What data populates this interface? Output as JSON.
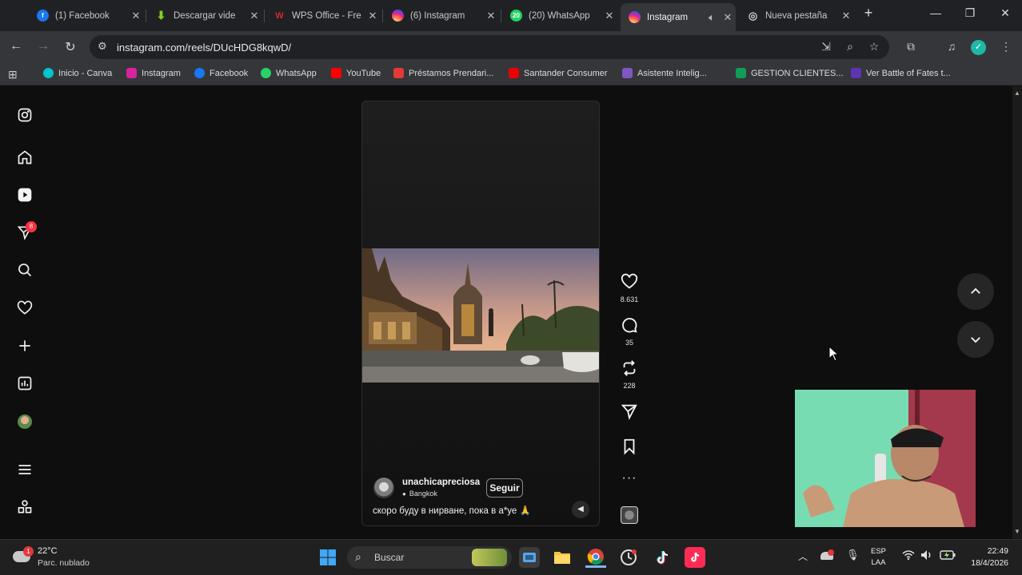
{
  "tabs": [
    {
      "title": "(1) Facebook",
      "icon": "facebook-icon",
      "color": "#1877f2"
    },
    {
      "title": "Descargar vide",
      "icon": "download-icon",
      "color": "#4caf50"
    },
    {
      "title": "WPS Office - Fre",
      "icon": "wps-icon",
      "color": "#d62a2a"
    },
    {
      "title": "(6) Instagram",
      "icon": "instagram-icon",
      "color": "#d6249f"
    },
    {
      "title": "(20) WhatsApp",
      "icon": "whatsapp-icon",
      "color": "#25d366",
      "badge": "20"
    },
    {
      "title": "Instagram",
      "icon": "instagram-icon",
      "color": "#d6249f",
      "active": true
    },
    {
      "title": "Nueva pestaña",
      "icon": "chrome-icon",
      "color": "#9e9e9e"
    }
  ],
  "url": "instagram.com/reels/DUcHDG8kqwD/",
  "bookmarks": [
    {
      "label": "Inicio - Canva",
      "color": "#00c4cc"
    },
    {
      "label": "Instagram",
      "color": "#d6249f"
    },
    {
      "label": "Facebook",
      "color": "#1877f2"
    },
    {
      "label": "WhatsApp",
      "color": "#25d366"
    },
    {
      "label": "YouTube",
      "color": "#ff0000"
    },
    {
      "label": "Préstamos Prendari...",
      "color": "#e53935"
    },
    {
      "label": "Santander Consumer",
      "color": "#ec0000"
    },
    {
      "label": "Asistente Intelig...",
      "color": "#7e57c2"
    },
    {
      "label": "GESTION CLIENTES...",
      "color": "#0f9d58"
    },
    {
      "label": "Ver Battle of Fates t...",
      "color": "#5e35b1"
    }
  ],
  "sidebar": {
    "notification_badge": "8",
    "items": [
      "instagram-logo-icon",
      "home-icon",
      "reels-icon",
      "messages-icon",
      "search-icon",
      "notifications-icon",
      "create-icon",
      "dashboard-icon",
      "profile-avatar",
      "more-icon",
      "also-from-meta-icon"
    ]
  },
  "reel": {
    "username": "unachicapreciosa",
    "location": "Bangkok",
    "follow_label": "Seguir",
    "caption": "скоро буду в нирване, пока в а*уе 🙏",
    "likes": "8.631",
    "comments": "35",
    "reposts": "228"
  },
  "taskbar": {
    "temperature": "22°C",
    "weather": "Parc. nublado",
    "search_placeholder": "Buscar",
    "language": "ESP",
    "layout": "LAA",
    "time": "22:49",
    "date": "18/4/2026",
    "weather_badge": "1"
  }
}
